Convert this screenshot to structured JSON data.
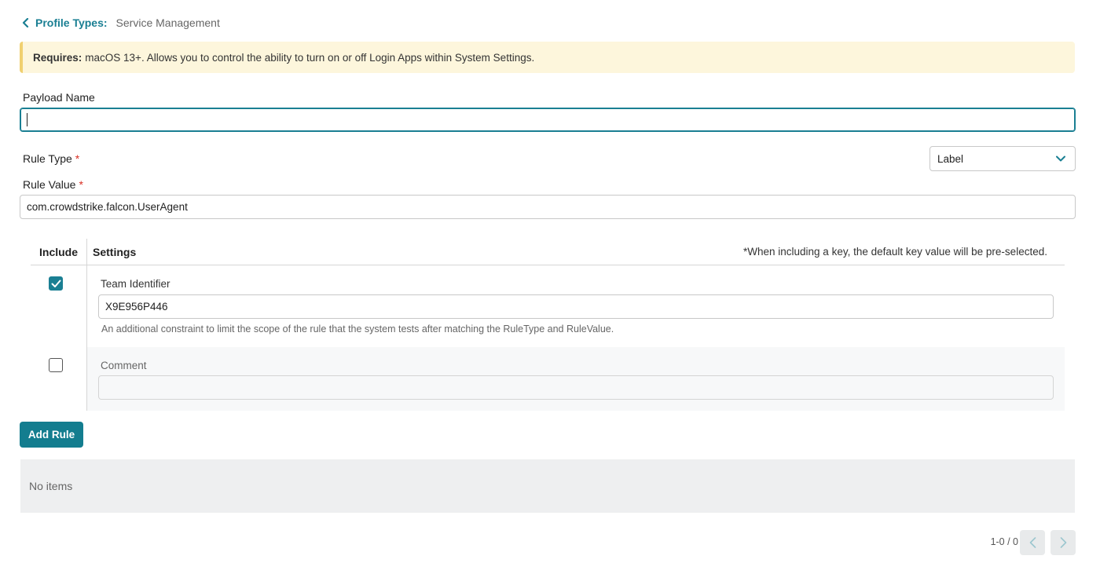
{
  "breadcrumb": {
    "back_label": "Profile Types:",
    "current": "Service Management"
  },
  "banner": {
    "bold": "Requires:",
    "text": "macOS 13+. Allows you to control the ability to turn on or off Login Apps within System Settings."
  },
  "form": {
    "payload_name_label": "Payload Name",
    "payload_name_value": "",
    "rule_type_label": "Rule Type",
    "rule_type_value": "Label",
    "rule_value_label": "Rule Value",
    "rule_value_value": "com.crowdstrike.falcon.UserAgent",
    "required_mark": "*"
  },
  "table": {
    "col_include": "Include",
    "col_settings": "Settings",
    "note": "*When including a key, the default key value will be pre-selected.",
    "rows": [
      {
        "checked": true,
        "label": "Team Identifier",
        "value": "X9E956P446",
        "help": "An additional constraint to limit the scope of the rule that the system tests after matching the RuleType and RuleValue."
      },
      {
        "checked": false,
        "label": "Comment",
        "value": ""
      }
    ]
  },
  "add_rule_label": "Add Rule",
  "list": {
    "empty_text": "No items"
  },
  "pagination": {
    "range": "1-0 / 0"
  },
  "colors": {
    "accent": "#1a7f93",
    "banner_bg": "#fdf6dc",
    "required": "#d93025"
  },
  "icons": {
    "back": "chevron-left-icon",
    "select": "chevron-down-icon",
    "checkbox": "checkmark-icon",
    "prev": "chevron-left-icon",
    "next": "chevron-right-icon"
  }
}
